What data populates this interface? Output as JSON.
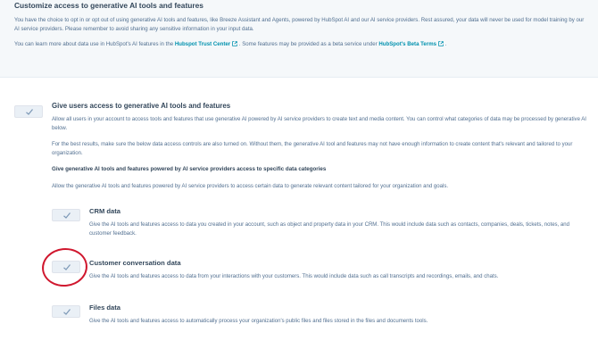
{
  "banner": {
    "title": "Customize access to generative AI tools and features",
    "paragraph": "You have the choice to opt in or opt out of using generative AI tools and features, like Breeze Assistant and Agents, powered by HubSpot AI and our AI service providers. Rest assured, your data will never be used for model training by our AI service providers. Please remember to avoid sharing any sensitive information in your input data.",
    "trust_prefix": "You can learn more about data use in HubSpot's AI features in the",
    "trust_link": "Hubspot Trust Center",
    "beta_prefix": ". Some features may be provided as a beta service under",
    "beta_link": "HubSpot's Beta Terms",
    "beta_suffix": "."
  },
  "main": {
    "title": "Give users access to generative AI tools and features",
    "description": "Allow all users in your account to access tools and features that use generative AI powered by AI service providers to create text and media content. You can control what categories of data may be processed by generative AI below.",
    "best_results": "For the best results, make sure the below data access controls are also turned on. Without them, the generative AI tool and features may not have enough information to create content that's relevant and tailored to your organization.",
    "data_heading": "Give generative AI tools and features powered by AI service providers access to specific data categories",
    "data_description": "Allow the generative AI tools and features powered by AI service providers to access certain data to generate relevant content tailored for your organization and goals.",
    "toggle_enabled": true
  },
  "categories": [
    {
      "title": "CRM data",
      "description": "Give the AI tools and features access to data you created in your account, such as object and property data in your CRM. This would include data such as contacts, companies, deals, tickets, notes, and customer feedback.",
      "enabled": true
    },
    {
      "title": "Customer conversation data",
      "description": "Give the AI tools and features access to data from your interactions with your customers. This would include data such as call transcripts and recordings, emails, and chats.",
      "enabled": true
    },
    {
      "title": "Files data",
      "description": "Give the AI tools and features access to automatically process your organization's public files and files stored in the files and documents tools.",
      "enabled": true
    }
  ],
  "colors": {
    "link": "#0091ae",
    "annotation": "#d0172e",
    "toggle_bg": "#eaf0f6"
  },
  "icons": {
    "toggle": "check-icon",
    "external": "external-link-icon"
  }
}
